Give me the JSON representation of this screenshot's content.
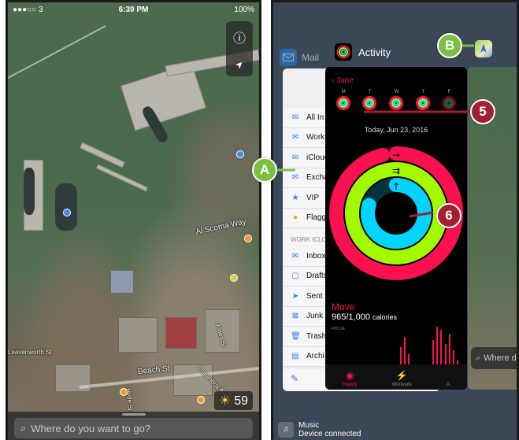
{
  "maps_phone": {
    "status": {
      "carrier": "●●●○○ 3",
      "time": "6:39 PM",
      "battery": "100%"
    },
    "controls": {
      "info_icon": "ⓘ",
      "location_icon": "➤"
    },
    "labels": {
      "street_scoma": "Al Scoma Way",
      "beach_st": "Beach St",
      "columbus_ave": "Columbus Ave",
      "jones_st": "Jones St",
      "hyde_st": "Hyde St",
      "leavenworth": "Leavenworth St"
    },
    "weather": {
      "temp": "59"
    },
    "search": {
      "placeholder": "Where do you want to go?"
    }
  },
  "switcher": {
    "mail_app_label": "Mail",
    "activity_app_label": "Activity",
    "mail_card": {
      "rows": [
        {
          "icon": "✉",
          "label": "All In"
        },
        {
          "icon": "✉",
          "label": "Work"
        },
        {
          "icon": "✉",
          "label": "iCloud"
        },
        {
          "icon": "✉",
          "label": "Excha"
        },
        {
          "icon": "★",
          "label": "VIP"
        },
        {
          "icon": "●",
          "label": "Flagg"
        }
      ],
      "section": "WORK ICLO",
      "folders": [
        {
          "icon": "✉",
          "label": "Inbox"
        },
        {
          "icon": "▢",
          "label": "Drafts"
        },
        {
          "icon": "➤",
          "label": "Sent"
        },
        {
          "icon": "⊠",
          "label": "Junk"
        },
        {
          "icon": "🗑",
          "label": "Trash"
        },
        {
          "icon": "▤",
          "label": "Archi"
        }
      ],
      "compose_icon": "✎"
    },
    "activity_card": {
      "month": "June",
      "week_letters": [
        "M",
        "T",
        "W",
        "T",
        "F"
      ],
      "date": "Today, Jun 23, 2016",
      "move_label": "Move",
      "move_value": "965/1,000",
      "move_unit": "calories",
      "chart_label": "450CAL",
      "tabs": [
        "History",
        "Workouts",
        "A"
      ]
    },
    "maps_card": {
      "search": "Where do"
    },
    "music": {
      "title": "Music",
      "subtitle": "Device connected"
    }
  },
  "callouts": {
    "a": "A",
    "b": "B",
    "five": "5",
    "six": "6"
  },
  "colors": {
    "move": "#fa114f",
    "exercise": "#a3f900",
    "stand": "#00d4ff",
    "callout_green": "#7ac143",
    "callout_red": "#a32033"
  },
  "chart_data": {
    "type": "bar",
    "title": "",
    "series": [
      {
        "name": "Move",
        "values": [
          0,
          0,
          0,
          0,
          0,
          0,
          0,
          0,
          0,
          0,
          0,
          0,
          0,
          0,
          0,
          0,
          0,
          30,
          45,
          20,
          0,
          0,
          0,
          0,
          0,
          40,
          60,
          55,
          35,
          50,
          25,
          10
        ]
      }
    ],
    "ylabel": "450CAL"
  }
}
